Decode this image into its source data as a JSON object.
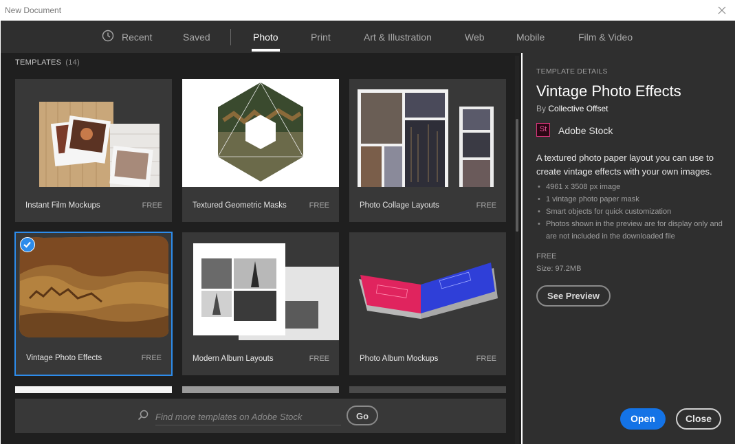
{
  "window": {
    "title": "New Document"
  },
  "tabs": [
    {
      "label": "Recent",
      "icon": "clock-icon"
    },
    {
      "label": "Saved"
    },
    {
      "label": "Photo",
      "active": true
    },
    {
      "label": "Print"
    },
    {
      "label": "Art & Illustration"
    },
    {
      "label": "Web"
    },
    {
      "label": "Mobile"
    },
    {
      "label": "Film & Video"
    }
  ],
  "templates": {
    "heading": "TEMPLATES",
    "count": "(14)",
    "items": [
      {
        "name": "Instant Film Mockups",
        "price": "FREE"
      },
      {
        "name": "Textured Geometric Masks",
        "price": "FREE"
      },
      {
        "name": "Photo Collage Layouts",
        "price": "FREE"
      },
      {
        "name": "Vintage Photo Effects",
        "price": "FREE",
        "selected": true
      },
      {
        "name": "Modern Album Layouts",
        "price": "FREE"
      },
      {
        "name": "Photo Album Mockups",
        "price": "FREE"
      }
    ]
  },
  "search": {
    "placeholder": "Find more templates on Adobe Stock",
    "button": "Go"
  },
  "details": {
    "label": "TEMPLATE DETAILS",
    "title": "Vintage Photo Effects",
    "by_prefix": "By",
    "author": "Collective Offset",
    "stock_logo": "St",
    "stock_name": "Adobe Stock",
    "description": "A textured photo paper layout you can use to create vintage effects with your own images.",
    "bullets": [
      "4961 x 3508 px image",
      "1 vintage photo paper mask",
      "Smart objects for quick customization",
      "Photos shown in the preview are for display only and are not included in the downloaded file"
    ],
    "price": "FREE",
    "size": "Size: 97.2MB",
    "preview_button": "See Preview"
  },
  "actions": {
    "open": "Open",
    "close": "Close"
  },
  "colors": {
    "accent": "#1473e6",
    "selection": "#2d8ceb",
    "stock": "#d9347a"
  }
}
